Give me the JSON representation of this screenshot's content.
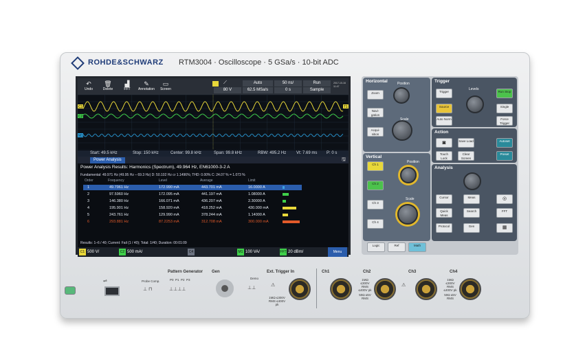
{
  "brand": {
    "name": "ROHDE&SCHWARZ",
    "model": "RTM3004 · Oscilloscope · 5 GSa/s · 10-bit ADC"
  },
  "toolbar": {
    "buttons": [
      {
        "label": "Undo",
        "icon": "undo-icon"
      },
      {
        "label": "Delete",
        "icon": "trash-icon"
      },
      {
        "label": "FFT",
        "icon": "fft-icon"
      },
      {
        "label": "Annotation",
        "icon": "pen-icon"
      },
      {
        "label": "Screen",
        "icon": "screen-icon"
      }
    ],
    "trigger_params": {
      "row1": [
        "Auto",
        "50 ns/",
        "Run"
      ],
      "row2": [
        "80 V",
        "62.5 MSa/s",
        "0 s",
        "Sample"
      ],
      "clock": "2017-10-16 11:47"
    }
  },
  "waves": {
    "labels": [
      "C1",
      "C2",
      "M1",
      "T1"
    ]
  },
  "spectrum_bar": {
    "start": "Start: 49.5 kHz",
    "stop": "Stop: 150 kHz",
    "center": "Center: 99.8 kHz",
    "span": "Span: 99.8 kHz",
    "rbw": "RBW: 495.2 Hz",
    "vt": "Vt: 7.69 ms",
    "p": "P: 0 s"
  },
  "tab": {
    "label": "Power Analysis"
  },
  "power_analysis": {
    "title": "Power Analysis Results: Harmonics (Spectrum), 49.964 Hz, EN61000-3-2 A",
    "fundamental": "Fundamental: 49.971 Hz (49.95 Hz – 69.3 Hz) D: 50.102 Hz  cr 1.1496%; THD: 0.00% C: 24.07 % = 1.073 %",
    "headers": [
      "Order",
      "Frequency",
      "Level",
      "Average",
      "Limit"
    ],
    "rows": [
      {
        "order": "1",
        "freq": "49.7961 Hz",
        "level": "172.990 mA",
        "avg": "443.701 mA",
        "limit": "16.0000 A",
        "bar": 0.12,
        "color": "#3fa0e0",
        "highlight": true
      },
      {
        "order": "2",
        "freq": "97.5960 Hz",
        "level": "172.095 mA",
        "avg": "441.197 mA",
        "limit": "1.08000 A",
        "bar": 0.35,
        "color": "#3fd04a",
        "highlight": false
      },
      {
        "order": "3",
        "freq": "146.380 Hz",
        "level": "166.071 mA",
        "avg": "436.207 mA",
        "limit": "2.30000 A",
        "bar": 0.18,
        "color": "#3fd04a",
        "highlight": false
      },
      {
        "order": "4",
        "freq": "195.901 Hz",
        "level": "158.920 mA",
        "avg": "418.252 mA",
        "limit": "430.000 mA",
        "bar": 0.75,
        "color": "#e8d83a",
        "highlight": false
      },
      {
        "order": "5",
        "freq": "243.761 Hz",
        "level": "129.990 mA",
        "avg": "378.244 mA",
        "limit": "1.14000 A",
        "bar": 0.32,
        "color": "#e8d83a",
        "highlight": false
      },
      {
        "order": "6",
        "freq": "293.881 Hz",
        "level": "87.2253 mA",
        "avg": "312.708 mA",
        "limit": "300.000 mA",
        "bar": 0.95,
        "color": "#e25a2a",
        "highlight": false
      }
    ],
    "results": "Results: 1–6 / 40; Current: Fail (1 / 40); Total: 1/40; Duration: 00:01:09"
  },
  "status": {
    "ch1": {
      "tag": "C1",
      "value": "500 V/",
      "color": "#e8d83a"
    },
    "ch2": {
      "tag": "C2",
      "value": "500 mA/",
      "color": "#3fd04a"
    },
    "c4": {
      "tag": "C4",
      "value": "",
      "color": "#6b7280"
    },
    "m1": {
      "tag": "M1",
      "value": "100 VA/",
      "color": "#3fd04a"
    },
    "fft": {
      "tag": "FFT",
      "value": "20 dBm/",
      "color": "#3fd04a"
    },
    "menu": "Menu"
  },
  "panel": {
    "horizontal": {
      "title": "Horizontal",
      "keys": [
        "Zoom",
        "Navi-gation",
        "Acqui-sition"
      ],
      "knobs": [
        "Position",
        "Scale"
      ]
    },
    "trigger": {
      "title": "Trigger",
      "keys": [
        "Trigger",
        "Run Stop",
        "Source",
        "Single",
        "Auto Norm",
        "Force Trigger"
      ],
      "knob": "Levels"
    },
    "action": {
      "title": "Action",
      "keys": [
        "Save Load",
        "Autoset",
        "Touch Lock",
        "Clear Screen",
        "Preset"
      ]
    },
    "vertical": {
      "title": "Vertical",
      "keys": [
        "Ch 1",
        "Ch 2",
        "Ch 3",
        "Ch 4"
      ],
      "knob_labels": [
        "Position",
        "Scale"
      ]
    },
    "analysis": {
      "title": "Analysis",
      "keys": [
        "Cursor",
        "Meas",
        "Quick Meas",
        "Search",
        "FFT",
        "Protocol",
        "Gen"
      ]
    },
    "bottom": [
      "Logic",
      "Ref",
      "Math"
    ]
  },
  "front": {
    "pattern_generator": "Pattern Generator",
    "probe_comp": "Probe Comp.",
    "pattern_pins": [
      "P0",
      "P1",
      "P2",
      "P3"
    ],
    "gen": "Gen",
    "demo": "Demo",
    "ext_trigger": "Ext. Trigger In",
    "ext_spec": "1MΩ ≤300V RMS ≤400V pk",
    "channels": [
      "Ch1",
      "Ch2",
      "Ch3",
      "Ch4"
    ],
    "ch_spec": "1MΩ ≤300V RMS ≤400V pk",
    "ch_spec2": "50Ω ≤5V RMS"
  }
}
